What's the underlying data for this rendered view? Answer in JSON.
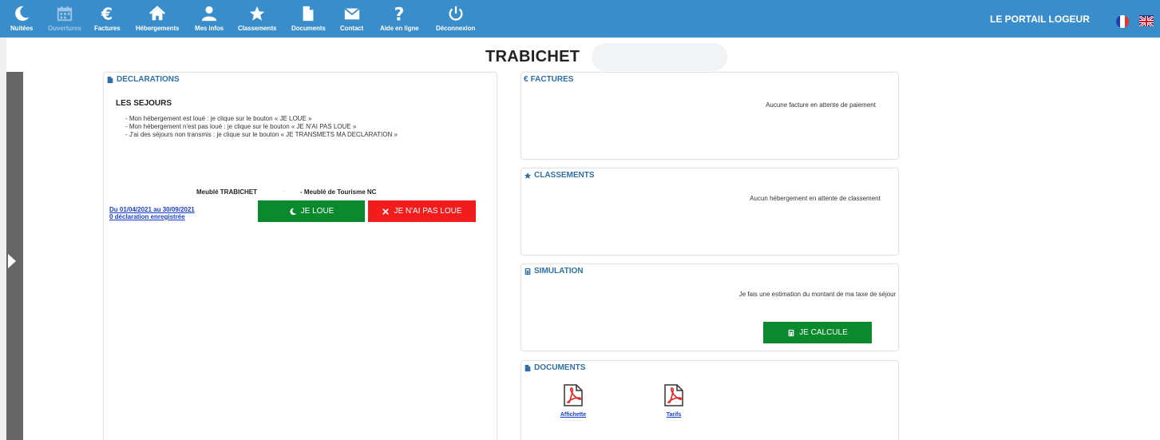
{
  "nav": {
    "items": [
      {
        "label": "Nuitées",
        "icon": "moon-icon"
      },
      {
        "label": "Ouvertures",
        "icon": "calendar-icon"
      },
      {
        "label": "Factures",
        "icon": "euro-icon"
      },
      {
        "label": "Hébergements",
        "icon": "home-icon"
      },
      {
        "label": "Mes infos",
        "icon": "user-icon"
      },
      {
        "label": "Classements",
        "icon": "star-icon"
      },
      {
        "label": "Documents",
        "icon": "file-icon"
      },
      {
        "label": "Contact",
        "icon": "envelope-icon"
      },
      {
        "label": "Aide en ligne",
        "icon": "question-icon"
      },
      {
        "label": "Déconnexion",
        "icon": "power-icon"
      }
    ],
    "brand": "LE PORTAIL LOGEUR"
  },
  "page": {
    "title": "TRABICHET"
  },
  "declarations": {
    "title": "DECLARATIONS",
    "heading": "LES SEJOURS",
    "lines": [
      "- Mon hébergement est loué : je clique sur le bouton « JE LOUE »",
      "- Mon hébergement n'est pas loué : je clique sur le bouton « JE N'AI PAS LOUE »",
      "- J'ai des séjours non transmis : je clique sur le bouton « JE TRANSMETS MA DECLARATION »"
    ],
    "property_name": "Meublé TRABICHET",
    "property_separator": "-",
    "property_type": "- Meublé de Tourisme NC",
    "period_link": "Du 01/04/2021 au 30/09/2021",
    "count_link": "0 déclaration enregistrée",
    "rent_button": "JE LOUE",
    "not_rented_button": "JE N'AI PAS LOUE"
  },
  "factures": {
    "title": "FACTURES",
    "message": "Aucune facture en attente de paiement"
  },
  "classements": {
    "title": "CLASSEMENTS",
    "message": "Aucun hébergement en attente de classement"
  },
  "simulation": {
    "title": "SIMULATION",
    "message": "Je fais une estimation du montant de ma taxe de séjour",
    "button": "JE CALCULE"
  },
  "documents": {
    "title": "DOCUMENTS",
    "files": [
      "Affichette",
      "Tarifs"
    ]
  },
  "colors": {
    "nav": "#3a8dcb",
    "green": "#0a8a2c",
    "red": "#f31c1c",
    "title_blue": "#2f6fa6"
  }
}
